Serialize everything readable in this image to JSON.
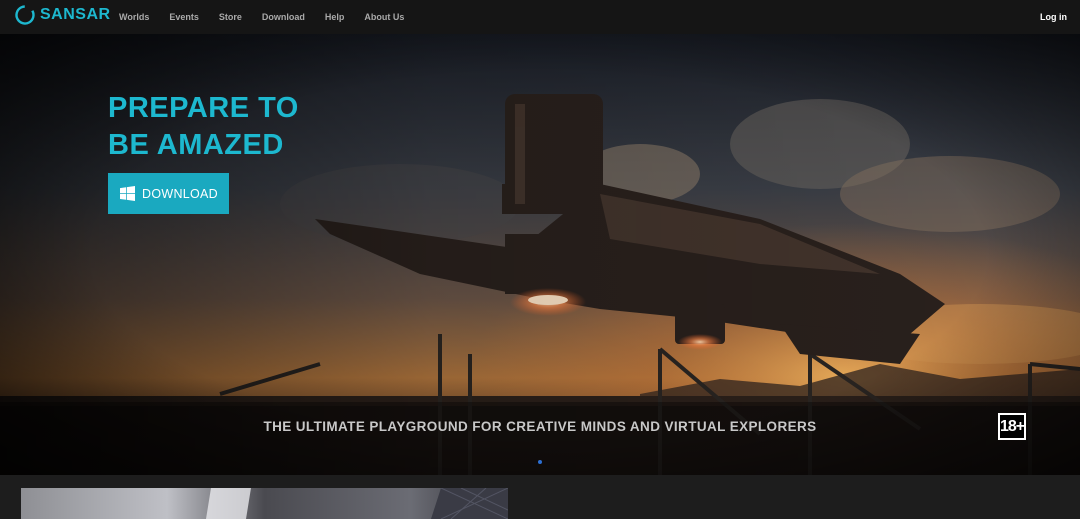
{
  "brand": {
    "name": "SANSAR",
    "accent_color": "#1db8cf",
    "logo_icon": "sansar-ring-icon"
  },
  "nav": {
    "items": [
      {
        "label": "Worlds"
      },
      {
        "label": "Events"
      },
      {
        "label": "Store"
      },
      {
        "label": "Download"
      },
      {
        "label": "Help"
      },
      {
        "label": "About Us"
      }
    ],
    "login_label": "Log in"
  },
  "hero": {
    "title_line1": "PREPARE TO",
    "title_line2": "BE AMAZED",
    "download_label": "DOWNLOAD",
    "download_icon": "windows-logo-icon",
    "button_color": "#1aa9c0",
    "tagline": "THE ULTIMATE PLAYGROUND FOR CREATIVE MINDS AND VIRTUAL EXPLORERS",
    "age_rating": "18+",
    "slides": 1,
    "active_slide": 1,
    "dot_color": "#2c6fd1"
  }
}
